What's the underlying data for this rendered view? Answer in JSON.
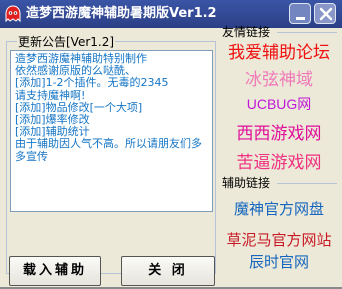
{
  "window": {
    "title": "造梦西游魔神辅助暑期版Ver1.2",
    "icon": "red-ghost-icon",
    "minimize_label": "_",
    "close_label": "×"
  },
  "notice": {
    "legend": "更新公告[Ver1.2]",
    "lines": [
      "造梦西游魔神辅助特别制作",
      "依然感谢原版的么哒酰、",
      "[添加]1-2个插件。无毒的2345",
      "请支持魔神啊!",
      "[添加]物品修改[一个大项]",
      "[添加]爆率修改",
      "[添加]辅助统计",
      "由于辅助因人气不高。所以请朋友们多多宣传"
    ]
  },
  "buttons": {
    "load_label": "载入辅助",
    "close_label": "关 闭"
  },
  "friend_links": {
    "legend": "友情链接",
    "items": [
      {
        "label": "我爱辅助论坛",
        "color": "#f01010"
      },
      {
        "label": "冰弦神域",
        "color": "#f079b8"
      },
      {
        "label": "UCBUG网",
        "color": "#c018d8"
      },
      {
        "label": "西西游戏网",
        "color": "#e0109a"
      },
      {
        "label": "苦逼游戏网",
        "color": "#f03080"
      }
    ]
  },
  "aux_links": {
    "legend": "辅助链接",
    "items": [
      {
        "label": "魔神官方网盘",
        "color": "#1566bf"
      },
      {
        "label": "草泥马官方网站",
        "color": "#c81a26"
      },
      {
        "label": "辰时官网",
        "color": "#1566bf"
      }
    ]
  }
}
